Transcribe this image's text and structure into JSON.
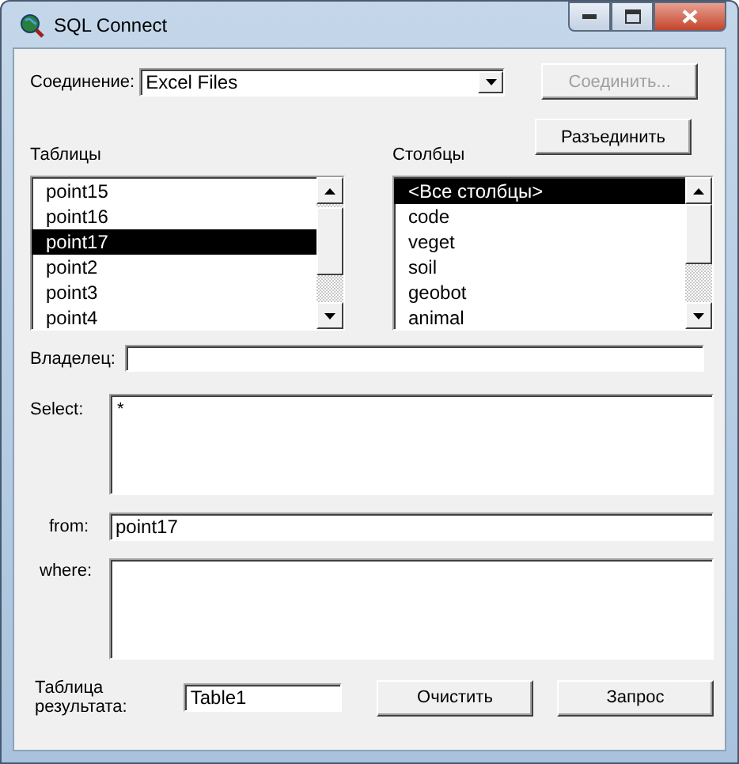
{
  "window": {
    "title": "SQL Connect"
  },
  "connection": {
    "label": "Соединение:",
    "value": "Excel Files"
  },
  "connect_button": {
    "label": "Соединить...",
    "disabled": true
  },
  "disconnect_button": {
    "label": "Разъединить",
    "disabled": false
  },
  "tables": {
    "label": "Таблицы",
    "items": [
      {
        "text": "point15",
        "selected": false
      },
      {
        "text": "point16",
        "selected": false
      },
      {
        "text": "point17",
        "selected": true
      },
      {
        "text": "point2",
        "selected": false
      },
      {
        "text": "point3",
        "selected": false
      },
      {
        "text": "point4",
        "selected": false
      }
    ]
  },
  "columns": {
    "label": "Столбцы",
    "items": [
      {
        "text": "<Все столбцы>",
        "selected": true
      },
      {
        "text": "code",
        "selected": false
      },
      {
        "text": "veget",
        "selected": false
      },
      {
        "text": "soil",
        "selected": false
      },
      {
        "text": "geobot",
        "selected": false
      },
      {
        "text": "animal",
        "selected": false
      }
    ]
  },
  "owner": {
    "label": "Владелец:"
  },
  "select": {
    "label": "Select:",
    "value": "*"
  },
  "from": {
    "label": "from:",
    "value": "point17"
  },
  "where": {
    "label": "where:"
  },
  "result_table": {
    "label": "Таблица результата:",
    "value": "Table1"
  },
  "clear_button": {
    "label": "Очистить",
    "disabled": false
  },
  "query_button": {
    "label": "Запрос",
    "disabled": false
  }
}
